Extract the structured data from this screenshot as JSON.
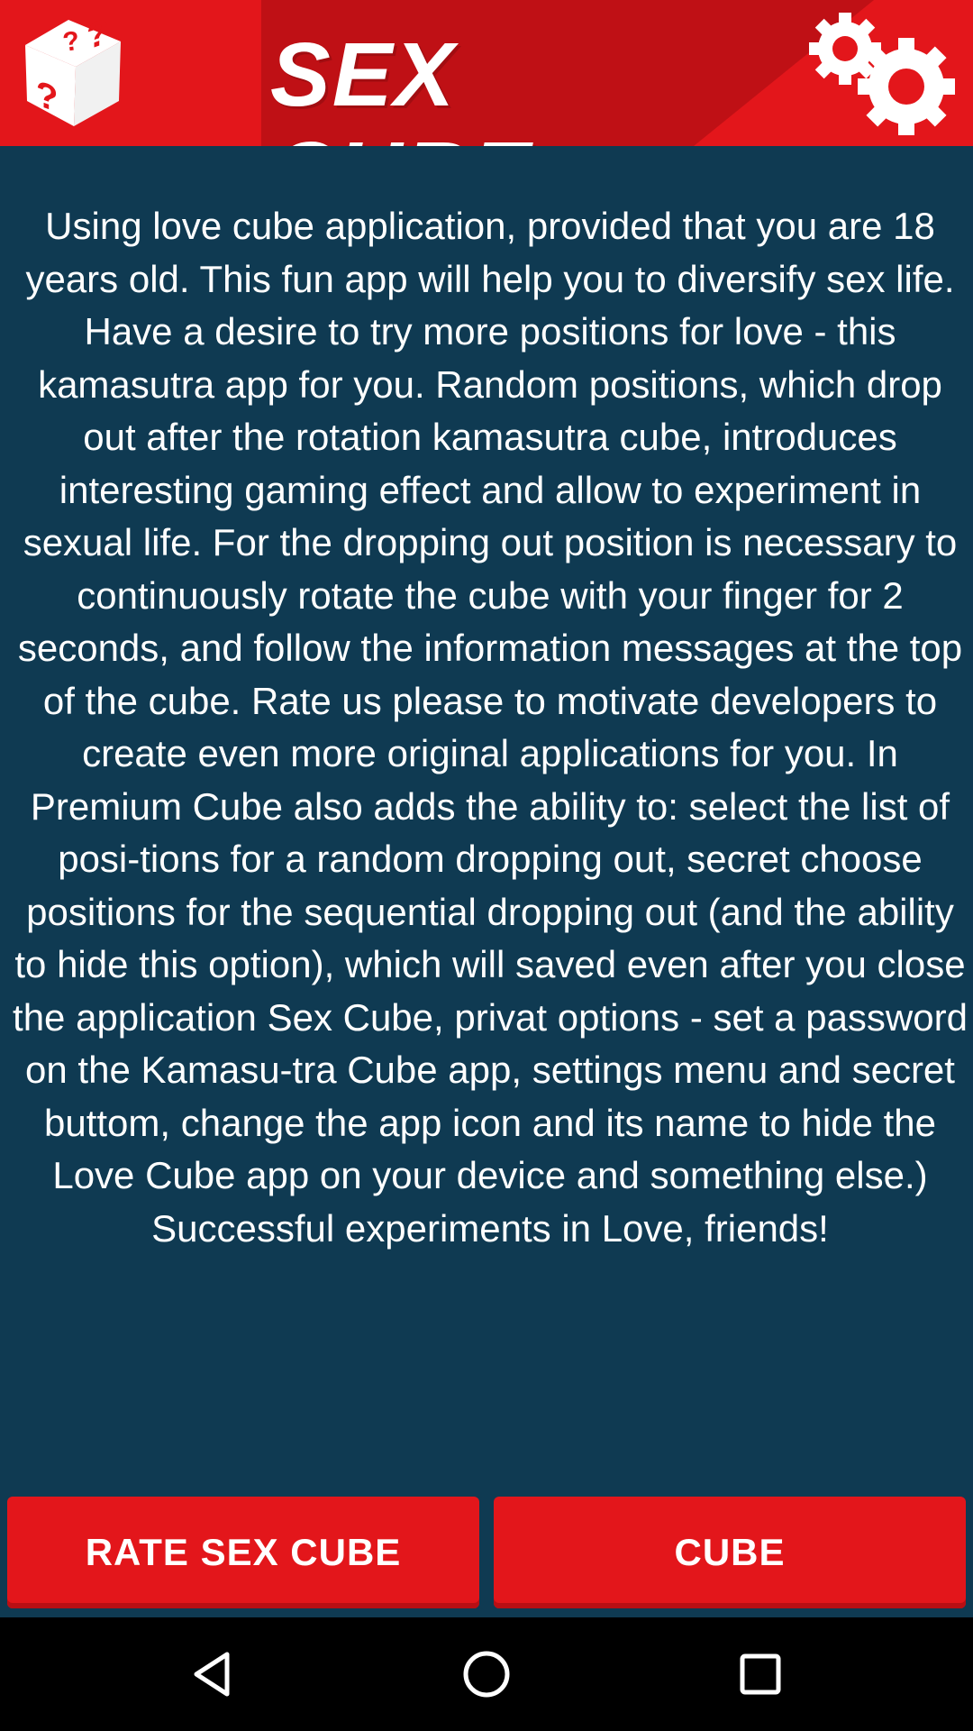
{
  "app": {
    "title": "SEX CUBE",
    "brand_color": "#e3161b",
    "background_color": "#0f3a52"
  },
  "header": {
    "left_icon": "dice-icon",
    "right_icon": "settings-gear-icon"
  },
  "description": {
    "text": "Using love cube application, provided that you are 18 years old. This fun app will help you to diversify sex life. Have a desire to try more positions for love - this kamasutra app for you. Random positions, which drop out after the rotation kamasutra cube, introduces interesting gaming effect and allow to experiment in sexual life. For the dropping out position is necessary to continuously rotate the cube with your finger for 2 seconds, and follow the information messages at the top of the cube. Rate us please to motivate developers to create even more original applications for you. In Premium Cube also adds the ability to: select the list of posi-tions for a random dropping out, secret choose positions for the sequential dropping out (and the ability to hide this option), which will saved even after you close the application Sex Cube, privat options - set a password on the Kamasu-tra Cube app, settings menu and secret buttom, change the app icon and its name to hide the Love Cube app on your device and something else.) Successful experiments in Love, friends!"
  },
  "buttons": {
    "rate_label": "RATE SEX CUBE",
    "cube_label": "CUBE"
  },
  "navbar": {
    "back_icon": "back-triangle-icon",
    "home_icon": "home-circle-icon",
    "recent_icon": "recent-square-icon"
  }
}
